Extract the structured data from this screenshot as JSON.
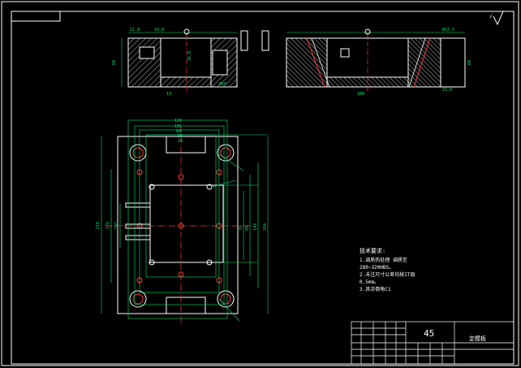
{
  "drawing": {
    "colors": {
      "background": "#000000",
      "frame": "#ffffff",
      "outline": "#ffffff",
      "dimension": "#00e676",
      "centerline": "#ff3b3b",
      "hatch": "#ffffff",
      "pin": "#ff3b3b"
    },
    "top_view": {
      "dimensions_horizontal": [
        "126",
        "105",
        "84",
        "36",
        "29"
      ],
      "dimensions_vertical": [
        "210",
        "172",
        "102",
        "160"
      ],
      "dimensions_vertical_right": [
        "72",
        "95",
        "149",
        "164"
      ]
    },
    "technical_requirements": {
      "heading": "技术要求:",
      "items": [
        "1.调质热处理 调质至",
        "280~320HBS。",
        "2.未注尺寸公差均按ΙΤ级",
        "0.5mm。",
        "3.其余倒角C1"
      ]
    },
    "title_block": {
      "material": "45",
      "part_name": "定模板"
    }
  }
}
